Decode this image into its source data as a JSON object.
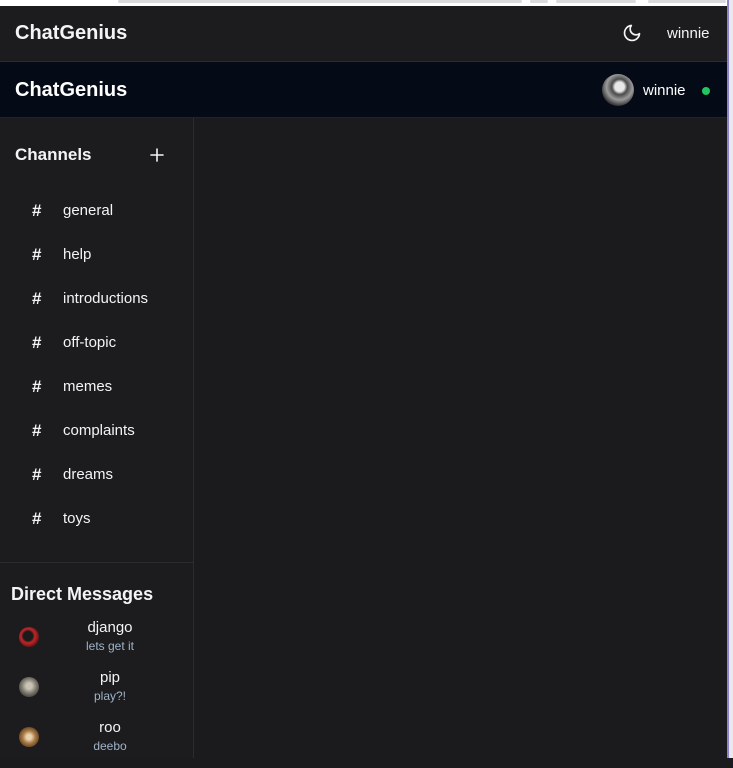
{
  "app": {
    "title": "ChatGenius"
  },
  "top_header": {
    "brand": "ChatGenius",
    "username": "winnie",
    "theme_icon": "moon-icon"
  },
  "app_header": {
    "brand": "ChatGenius",
    "username": "winnie",
    "status_color": "#22c55e"
  },
  "sidebar": {
    "channels_title": "Channels",
    "add_icon": "plus-icon",
    "channels": [
      {
        "label": "general"
      },
      {
        "label": "help"
      },
      {
        "label": "introductions"
      },
      {
        "label": "off-topic"
      },
      {
        "label": "memes"
      },
      {
        "label": "complaints"
      },
      {
        "label": "dreams"
      },
      {
        "label": "toys"
      }
    ],
    "dm_title": "Direct Messages",
    "dms": [
      {
        "name": "django",
        "last_message": "lets get it"
      },
      {
        "name": "pip",
        "last_message": "play?!"
      },
      {
        "name": "roo",
        "last_message": "deebo"
      }
    ]
  },
  "colors": {
    "accent": "#22c55e",
    "header_bg": "#050a17",
    "subtext": "#9fb3c8"
  }
}
